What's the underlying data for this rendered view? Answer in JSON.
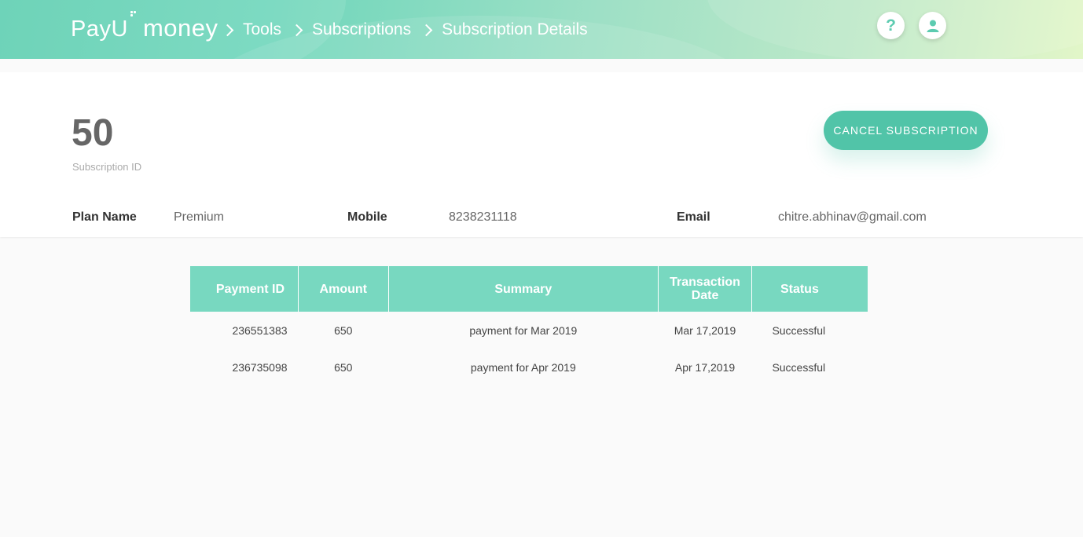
{
  "header": {
    "logo_left": "Pay",
    "logo_u": "U",
    "logo_right": "money",
    "breadcrumb": [
      "Tools",
      "Subscriptions",
      "Subscription Details"
    ],
    "help_icon": "?",
    "colors": {
      "header_start": "#5ecfb1",
      "header_end": "#e2f6c8",
      "accent": "#51c4a8"
    }
  },
  "subscription": {
    "id": "50",
    "id_label": "Subscription ID",
    "cancel_label": "CANCEL SUBSCRIPTION"
  },
  "info": {
    "plan_label": "Plan Name",
    "plan_value": "Premium",
    "mobile_label": "Mobile",
    "mobile_value": "8238231118",
    "email_label": "Email",
    "email_value": "chitre.abhinav@gmail.com"
  },
  "table": {
    "headers": [
      "Payment ID",
      "Amount",
      "Summary",
      "Transaction Date",
      "Status"
    ],
    "rows": [
      [
        "236551383",
        "650",
        "payment for Mar 2019",
        "Mar 17,2019",
        "Successful"
      ],
      [
        "236735098",
        "650",
        "payment for Apr 2019",
        "Apr 17,2019",
        "Successful"
      ]
    ]
  }
}
